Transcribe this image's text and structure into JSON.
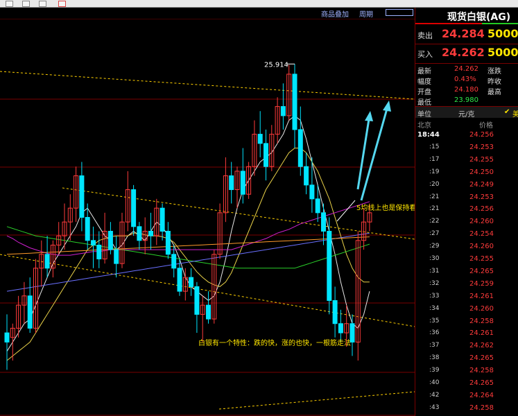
{
  "panel": {
    "title": "现货白银(AG)",
    "sell_label": "卖出",
    "sell_price": "24.284",
    "sell_qty": "5000",
    "buy_label": "买入",
    "buy_price": "24.262",
    "buy_qty": "5000",
    "stats": [
      {
        "label": "最新",
        "value": "24.262",
        "label2": "涨跌"
      },
      {
        "label": "幅度",
        "value": "0.43%",
        "label2": "昨收"
      },
      {
        "label": "开盘",
        "value": "24.180",
        "label2": "最高"
      },
      {
        "label": "最低",
        "value": "23.980",
        "label2": ""
      }
    ],
    "unit_label": "单位",
    "unit_value": "元/克",
    "unit_extra": "美",
    "col_time": "北京",
    "col_price": "价格",
    "ticks": [
      {
        "t": "18:44",
        "p": "24.256"
      },
      {
        "t": ":15",
        "p": "24.253"
      },
      {
        "t": ":17",
        "p": "24.255"
      },
      {
        "t": ":19",
        "p": "24.250"
      },
      {
        "t": ":20",
        "p": "24.249"
      },
      {
        "t": ":21",
        "p": "24.253"
      },
      {
        "t": ":21",
        "p": "24.256"
      },
      {
        "t": ":22",
        "p": "24.260"
      },
      {
        "t": ":27",
        "p": "24.254"
      },
      {
        "t": ":29",
        "p": "24.260"
      },
      {
        "t": ":30",
        "p": "24.255"
      },
      {
        "t": ":31",
        "p": "24.265"
      },
      {
        "t": ":32",
        "p": "24.259"
      },
      {
        "t": ":33",
        "p": "24.261"
      },
      {
        "t": ":34",
        "p": "24.260"
      },
      {
        "t": ":35",
        "p": "24.258"
      },
      {
        "t": ":36",
        "p": "24.261"
      },
      {
        "t": ":37",
        "p": "24.262"
      },
      {
        "t": ":38",
        "p": "24.265"
      },
      {
        "t": ":39",
        "p": "24.258"
      },
      {
        "t": ":40",
        "p": "24.265"
      },
      {
        "t": ":42",
        "p": "24.264"
      },
      {
        "t": ":43",
        "p": "24.258"
      }
    ]
  },
  "toolbar": {
    "overlay_label": "商品叠加",
    "period_label": "周期"
  },
  "annotations": {
    "high_label": "25.914",
    "ma_note": "5均线上也是保持看涨",
    "trait_note": "白银有一个特性：跌的快，涨的也快，一根筋走法"
  },
  "colors": {
    "up": "#ff3b3b",
    "down": "#00e5ff",
    "grid": "#7a0000",
    "accent": "#ffd000"
  },
  "chart_data": {
    "type": "candlestick",
    "candles": [
      [
        23.0,
        23.2,
        22.6,
        22.9
      ],
      [
        22.95,
        23.1,
        22.7,
        23.05
      ],
      [
        23.05,
        23.4,
        22.95,
        23.3
      ],
      [
        23.3,
        23.55,
        23.1,
        23.4
      ],
      [
        23.4,
        23.6,
        23.0,
        23.05
      ],
      [
        23.05,
        23.8,
        23.0,
        23.7
      ],
      [
        23.7,
        24.0,
        23.5,
        23.85
      ],
      [
        23.85,
        24.05,
        23.6,
        23.7
      ],
      [
        23.7,
        24.0,
        23.6,
        23.95
      ],
      [
        23.95,
        24.2,
        23.85,
        24.05
      ],
      [
        24.05,
        24.4,
        23.9,
        24.2
      ],
      [
        24.2,
        24.5,
        24.0,
        24.35
      ],
      [
        24.35,
        24.8,
        24.2,
        24.7
      ],
      [
        24.7,
        24.85,
        24.1,
        24.25
      ],
      [
        24.25,
        24.4,
        23.9,
        24.0
      ],
      [
        24.0,
        24.15,
        23.7,
        23.95
      ],
      [
        23.95,
        24.1,
        23.7,
        23.8
      ],
      [
        23.8,
        24.3,
        23.75,
        24.1
      ],
      [
        24.1,
        24.2,
        23.85,
        23.9
      ],
      [
        23.9,
        24.05,
        23.6,
        23.75
      ],
      [
        23.75,
        24.3,
        23.7,
        24.2
      ],
      [
        24.2,
        24.75,
        24.1,
        24.55
      ],
      [
        24.55,
        24.6,
        24.05,
        24.15
      ],
      [
        24.15,
        24.2,
        23.9,
        24.0
      ],
      [
        24.0,
        24.25,
        23.85,
        24.1
      ],
      [
        24.1,
        24.3,
        23.9,
        24.05
      ],
      [
        24.05,
        24.45,
        23.95,
        24.35
      ],
      [
        24.35,
        24.4,
        24.0,
        24.1
      ],
      [
        24.1,
        24.2,
        23.8,
        23.85
      ],
      [
        23.85,
        23.95,
        23.6,
        23.7
      ],
      [
        23.7,
        23.8,
        23.4,
        23.45
      ],
      [
        23.45,
        23.7,
        23.35,
        23.6
      ],
      [
        23.6,
        23.7,
        23.4,
        23.5
      ],
      [
        23.5,
        23.55,
        23.0,
        23.2
      ],
      [
        23.2,
        23.4,
        22.9,
        23.3
      ],
      [
        23.3,
        23.45,
        23.1,
        23.15
      ],
      [
        23.15,
        23.9,
        23.1,
        23.85
      ],
      [
        23.85,
        24.4,
        23.8,
        24.3
      ],
      [
        24.3,
        24.9,
        24.2,
        24.7
      ],
      [
        24.7,
        24.85,
        24.4,
        24.55
      ],
      [
        24.55,
        24.8,
        24.35,
        24.75
      ],
      [
        24.75,
        25.0,
        24.4,
        24.5
      ],
      [
        24.5,
        24.85,
        24.45,
        24.8
      ],
      [
        24.8,
        25.3,
        24.7,
        25.15
      ],
      [
        25.15,
        25.4,
        24.9,
        25.05
      ],
      [
        25.05,
        25.2,
        24.65,
        24.8
      ],
      [
        24.8,
        25.25,
        24.75,
        25.15
      ],
      [
        25.15,
        25.55,
        25.05,
        25.45
      ],
      [
        25.45,
        25.7,
        25.2,
        25.35
      ],
      [
        25.35,
        25.9,
        25.3,
        25.8
      ],
      [
        25.8,
        25.91,
        25.0,
        25.2
      ],
      [
        25.2,
        25.45,
        24.7,
        24.8
      ],
      [
        24.8,
        24.95,
        24.5,
        24.6
      ],
      [
        24.6,
        24.9,
        24.3,
        24.45
      ],
      [
        24.45,
        24.6,
        24.2,
        24.3
      ],
      [
        24.3,
        24.4,
        23.95,
        24.1
      ],
      [
        24.1,
        24.25,
        23.2,
        23.35
      ],
      [
        23.35,
        23.5,
        22.95,
        23.1
      ],
      [
        23.1,
        23.25,
        22.9,
        23.0
      ],
      [
        23.0,
        23.3,
        22.85,
        23.1
      ],
      [
        23.1,
        23.2,
        22.75,
        22.9
      ],
      [
        22.9,
        24.1,
        22.7,
        24.0
      ],
      [
        24.0,
        24.35,
        23.9,
        24.2
      ],
      [
        24.2,
        24.4,
        24.1,
        24.3
      ]
    ],
    "ma5": [
      22.8,
      22.9,
      23.0,
      23.1,
      23.15,
      23.3,
      23.45,
      23.6,
      23.75,
      23.85,
      23.95,
      24.05,
      24.15,
      24.3,
      24.35,
      24.25,
      24.15,
      24.05,
      24.0,
      23.9,
      23.95,
      24.05,
      24.1,
      24.05,
      24.0,
      24.1,
      24.2,
      24.15,
      24.05,
      23.95,
      23.8,
      23.6,
      23.5,
      23.45,
      23.4,
      23.35,
      23.4,
      23.55,
      23.8,
      24.1,
      24.35,
      24.55,
      24.65,
      24.75,
      24.85,
      24.9,
      24.95,
      25.05,
      25.15,
      25.3,
      25.35,
      25.3,
      25.1,
      24.85,
      24.6,
      24.35,
      24.1,
      23.85,
      23.55,
      23.3,
      23.1,
      23.05,
      23.2,
      23.45
    ],
    "ma10": [
      22.7,
      22.75,
      22.8,
      22.85,
      22.9,
      23.0,
      23.1,
      23.2,
      23.3,
      23.4,
      23.5,
      23.6,
      23.7,
      23.8,
      23.9,
      23.95,
      24.0,
      24.02,
      24.04,
      24.05,
      24.05,
      24.05,
      24.08,
      24.08,
      24.06,
      24.05,
      24.05,
      24.04,
      24.02,
      23.98,
      23.9,
      23.82,
      23.74,
      23.66,
      23.6,
      23.55,
      23.52,
      23.5,
      23.55,
      23.65,
      23.8,
      23.95,
      24.1,
      24.25,
      24.4,
      24.55,
      24.65,
      24.75,
      24.85,
      24.95,
      25.0,
      25.0,
      24.95,
      24.85,
      24.75,
      24.6,
      24.45,
      24.25,
      24.05,
      23.85,
      23.7,
      23.6,
      23.55,
      23.55
    ],
    "ma20": [
      24.05,
      24.02,
      23.98,
      23.95,
      23.92,
      23.9,
      23.88,
      23.86,
      23.85,
      23.84,
      23.84,
      23.84,
      23.85,
      23.86,
      23.87,
      23.88,
      23.88,
      23.89,
      23.9,
      23.9,
      23.9,
      23.9,
      23.9,
      23.9,
      23.9,
      23.9,
      23.9,
      23.9,
      23.9,
      23.9,
      23.9,
      23.9,
      23.9,
      23.9,
      23.9,
      23.9,
      23.9,
      23.9,
      23.9,
      23.9,
      23.92,
      23.94,
      23.96,
      23.98,
      24.0,
      24.02,
      24.05,
      24.08,
      24.1,
      24.12,
      24.15,
      24.18,
      24.2,
      24.22,
      24.24,
      24.26,
      24.28,
      24.3,
      24.32,
      24.34,
      24.36,
      24.38,
      24.4,
      24.42
    ],
    "ma30": [
      24.15,
      24.13,
      24.11,
      24.09,
      24.07,
      24.05,
      24.04,
      24.03,
      24.02,
      24.01,
      24.0,
      23.99,
      23.98,
      23.97,
      23.96,
      23.95,
      23.94,
      23.93,
      23.92,
      23.91,
      23.9,
      23.89,
      23.88,
      23.87,
      23.86,
      23.85,
      23.84,
      23.83,
      23.82,
      23.81,
      23.8,
      23.79,
      23.78,
      23.77,
      23.76,
      23.75,
      23.74,
      23.73,
      23.72,
      23.71,
      23.7,
      23.7,
      23.7,
      23.7,
      23.7,
      23.7,
      23.7,
      23.7,
      23.7,
      23.7,
      23.7,
      23.72,
      23.74,
      23.76,
      23.78,
      23.8,
      23.82,
      23.84,
      23.86,
      23.88,
      23.9,
      23.92,
      23.94,
      23.96
    ],
    "ma60": [
      23.45,
      23.46,
      23.47,
      23.48,
      23.49,
      23.5,
      23.51,
      23.52,
      23.53,
      23.54,
      23.55,
      23.56,
      23.57,
      23.58,
      23.59,
      23.6,
      23.61,
      23.62,
      23.63,
      23.64,
      23.65,
      23.66,
      23.67,
      23.68,
      23.69,
      23.7,
      23.71,
      23.72,
      23.73,
      23.74,
      23.75,
      23.76,
      23.77,
      23.78,
      23.79,
      23.8,
      23.81,
      23.82,
      23.83,
      23.84,
      23.85,
      23.86,
      23.87,
      23.88,
      23.89,
      23.9,
      23.91,
      23.92,
      23.93,
      23.94,
      23.95,
      23.96,
      23.97,
      23.98,
      23.99,
      24.0,
      24.01,
      24.02,
      24.03,
      24.04,
      24.05,
      24.06,
      24.07,
      24.08
    ],
    "ylim": [
      22.1,
      26.4
    ]
  }
}
